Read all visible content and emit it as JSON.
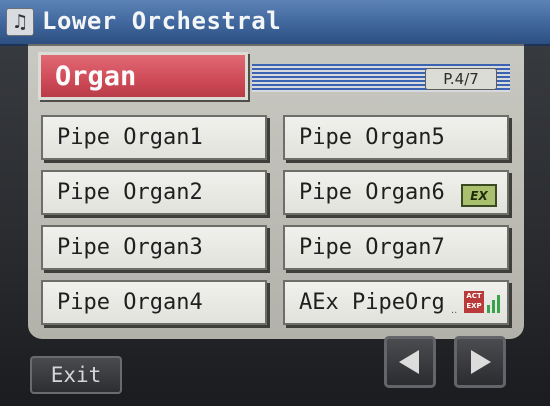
{
  "window": {
    "title": "Lower Orchestral",
    "icon": "music-note-icon"
  },
  "category": {
    "label": "Organ",
    "page": "P.4/7"
  },
  "tones": {
    "left": [
      {
        "label": "Pipe Organ1"
      },
      {
        "label": "Pipe Organ2"
      },
      {
        "label": "Pipe Organ3"
      },
      {
        "label": "Pipe Organ4"
      }
    ],
    "right": [
      {
        "label": "Pipe Organ5"
      },
      {
        "label": "Pipe Organ6",
        "badge": "EX"
      },
      {
        "label": "Pipe Organ7"
      },
      {
        "label": "AEx PipeOrg",
        "badge_lines": [
          "ACT",
          "EXP"
        ]
      }
    ]
  },
  "controls": {
    "exit_label": "Exit",
    "prev_icon": "triangle-left-icon",
    "next_icon": "triangle-right-icon"
  },
  "colors": {
    "titlebar": "#3f669c",
    "category_red": "#cf4a57",
    "ex_badge": "#a9c06f",
    "act_exp_badge": "#b93a3a"
  }
}
